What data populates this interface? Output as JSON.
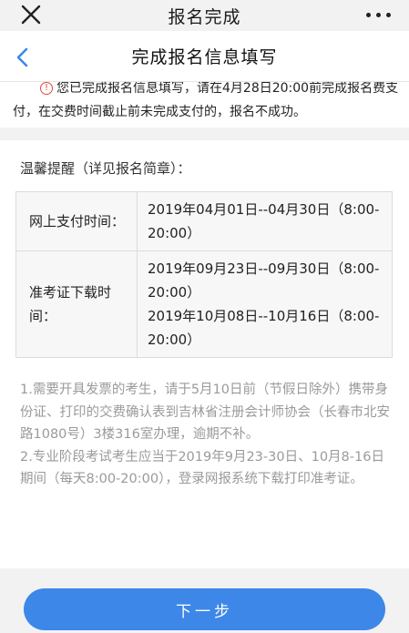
{
  "wechat_bar": {
    "title": "报名完成"
  },
  "nav": {
    "title": "完成报名信息填写"
  },
  "notice": {
    "line1": "您已完成报名信息填写，请在4月28日20:00前完成报名费支",
    "line2": "付，在交费时间截止前未完成支付的，报名不成功。"
  },
  "reminder": {
    "heading": "温馨提醒（详见报名简章）：",
    "rows": [
      {
        "label": "网上支付时间：",
        "values": [
          "2019年04月01日--04月30日（8:00-20:00）"
        ]
      },
      {
        "label": "准考证下载时间：",
        "values": [
          "2019年09月23日--09月30日（8:00-20:00）",
          "2019年10月08日--10月16日（8:00-20:00）"
        ]
      }
    ],
    "notes": [
      "1.需要开具发票的考生，请于5月10日前（节假日除外）携带身份证、打印的交费确认表到吉林省注册会计师协会（长春市北安路1080号）3楼316室办理，逾期不补。",
      "2.专业阶段考试考生应当于2019年9月23-30日、10月8-16日期间（每天8:00-20:00），登录网报系统下载打印准考证。"
    ]
  },
  "footer": {
    "next_label": "下一步"
  },
  "colors": {
    "accent": "#3d87e8",
    "warning": "#e04a3a",
    "note_text": "#9a9a9a"
  }
}
